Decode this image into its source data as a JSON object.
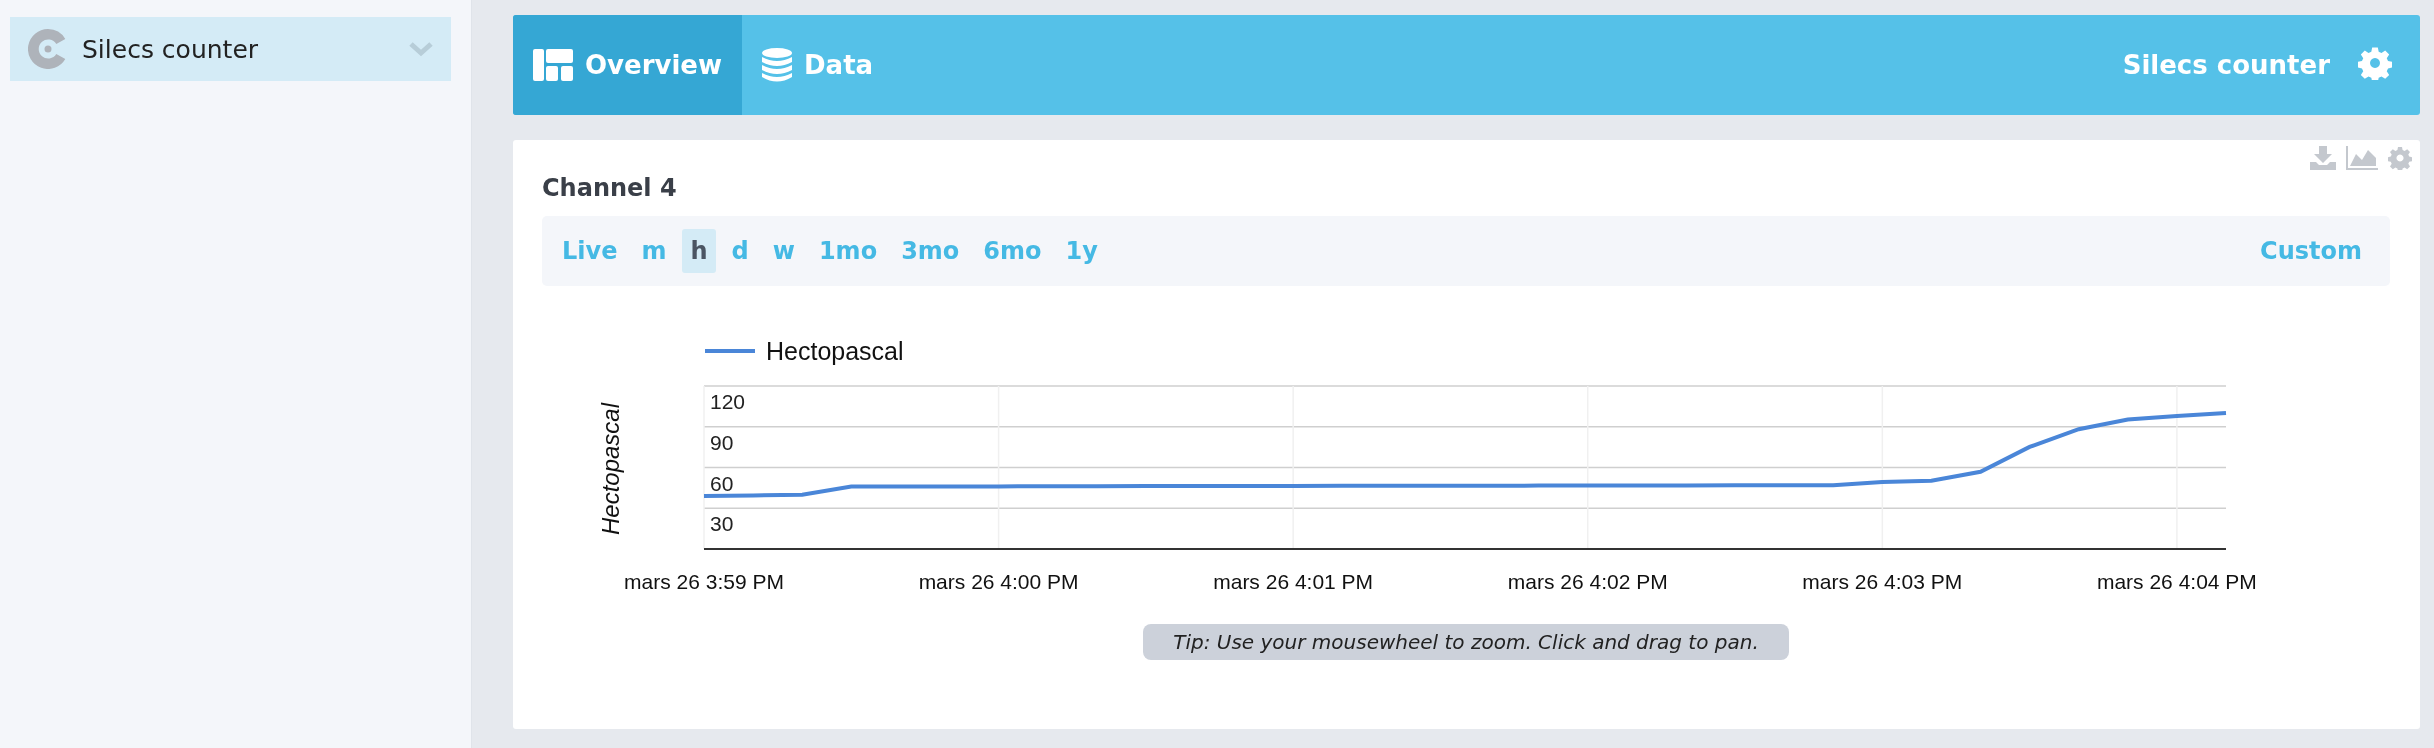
{
  "sidebar": {
    "items": [
      {
        "label": "Silecs counter",
        "selected": true
      }
    ]
  },
  "header": {
    "tabs": [
      {
        "label": "Overview",
        "kind": "overview",
        "selected": true
      },
      {
        "label": "Data",
        "kind": "data",
        "selected": false
      }
    ],
    "title": "Silecs counter"
  },
  "widget": {
    "title": "Channel 4",
    "ranges": [
      {
        "label": "Live",
        "selected": false
      },
      {
        "label": "m",
        "selected": false
      },
      {
        "label": "h",
        "selected": true
      },
      {
        "label": "d",
        "selected": false
      },
      {
        "label": "w",
        "selected": false
      },
      {
        "label": "1mo",
        "selected": false
      },
      {
        "label": "3mo",
        "selected": false
      },
      {
        "label": "6mo",
        "selected": false
      },
      {
        "label": "1y",
        "selected": false
      }
    ],
    "custom": {
      "label": "Custom",
      "selected": false
    },
    "chart_data": {
      "type": "line",
      "ylabel": "Hectopascal",
      "categories": [
        "mars 26 3:59 PM",
        null,
        null,
        null,
        null,
        null,
        "mars 26 4:00 PM",
        null,
        null,
        null,
        null,
        null,
        "mars 26 4:01 PM",
        null,
        null,
        null,
        null,
        null,
        "mars 26 4:02 PM",
        null,
        null,
        null,
        null,
        null,
        "mars 26 4:03 PM",
        null,
        null,
        null,
        null,
        null,
        "mars 26 4:04 PM",
        null
      ],
      "series": [
        {
          "name": "Hectopascal",
          "color": "#4a86d8",
          "values": [
            39,
            39.4,
            39.9,
            46,
            46,
            46.1,
            46.1,
            46.2,
            46.2,
            46.3,
            46.3,
            46.4,
            46.4,
            46.5,
            46.5,
            46.6,
            46.6,
            46.7,
            46.7,
            46.8,
            46.8,
            46.9,
            46.9,
            47,
            49.4,
            50.2,
            56.8,
            75.2,
            88.2,
            95.3,
            97.9,
            100.2
          ]
        }
      ],
      "ylim": [
        0,
        120
      ],
      "grid": true,
      "yticks": [
        30,
        60,
        90,
        120
      ]
    },
    "tip": "Tip: Use your mousewheel to zoom. Click and drag to pan."
  }
}
